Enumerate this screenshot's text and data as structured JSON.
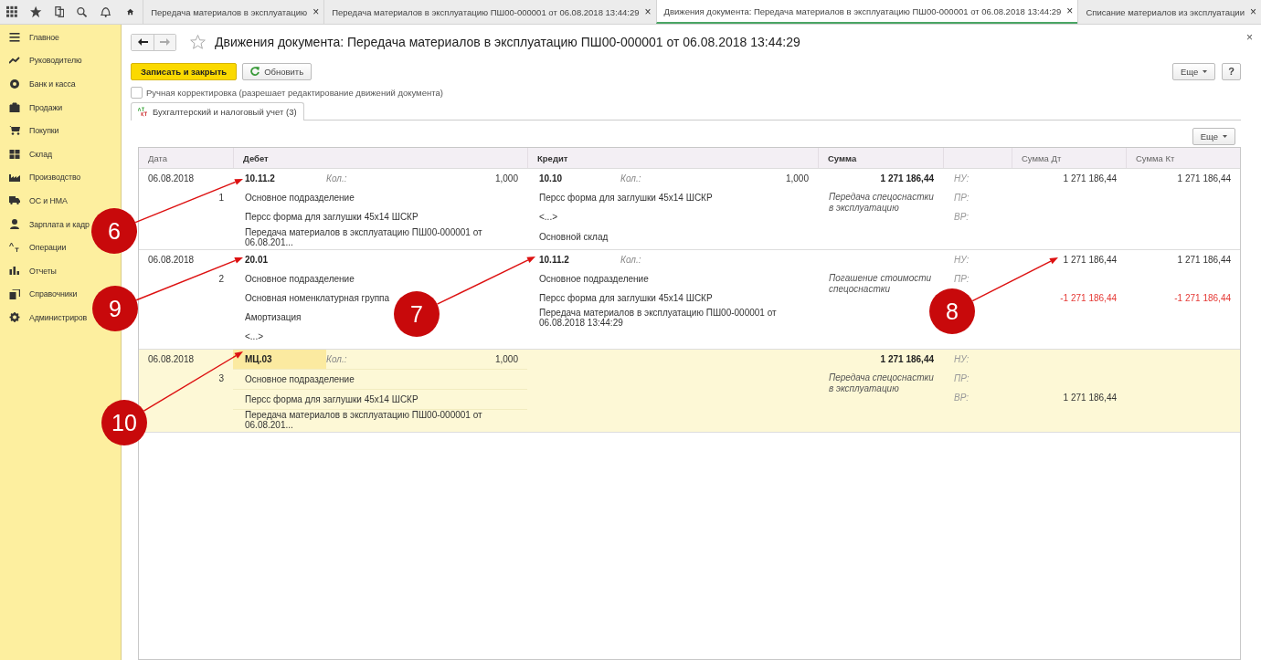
{
  "tabs": [
    {
      "label": "Передача материалов в эксплуатацию",
      "selected": false
    },
    {
      "label": "Передача материалов в эксплуатацию ПШ00-000001 от 06.08.2018 13:44:29",
      "selected": false
    },
    {
      "label": "Движения документа: Передача материалов в эксплуатацию ПШ00-000001 от 06.08.2018 13:44:29",
      "selected": true
    },
    {
      "label": "Списание материалов из эксплуатации",
      "selected": false
    }
  ],
  "tab_close": "×",
  "sidebar": {
    "items": [
      {
        "label": "Главное",
        "kind": "menu"
      },
      {
        "label": "Руководителю",
        "kind": "trend"
      },
      {
        "label": "Банк и касса",
        "kind": "coin"
      },
      {
        "label": "Продажи",
        "kind": "bag"
      },
      {
        "label": "Покупки",
        "kind": "cart"
      },
      {
        "label": "Склад",
        "kind": "grid"
      },
      {
        "label": "Производство",
        "kind": "factory"
      },
      {
        "label": "ОС и НМА",
        "kind": "truck"
      },
      {
        "label": "Зарплата и кадр",
        "kind": "person"
      },
      {
        "label": "Операции",
        "kind": "dtkt"
      },
      {
        "label": "Отчеты",
        "kind": "bars"
      },
      {
        "label": "Справочники",
        "kind": "books"
      },
      {
        "label": "Администриров",
        "kind": "gear"
      }
    ]
  },
  "form": {
    "title": "Движения документа: Передача материалов в эксплуатацию ПШ00-000001 от 06.08.2018 13:44:29",
    "close": "×",
    "buttons": [
      {
        "label": "Записать и закрыть",
        "kind": "primary"
      },
      {
        "label": "Обновить",
        "kind": "refresh"
      }
    ],
    "more": "Еще",
    "help": "?",
    "manual_edit": {
      "label": "Ручная корректировка (разрешает редактирование движений документа)",
      "checked": false
    },
    "section_tab": {
      "label": "Бухгалтерский и налоговый учет (3)",
      "selected": true
    },
    "table_more": "Еще"
  },
  "table": {
    "columns": [
      "Дата",
      "Дебет",
      "Кредит",
      "Сумма",
      "Сумма Дт",
      "Сумма Кт"
    ],
    "rows": [
      {
        "date": "06.08.2018",
        "number": "1",
        "selected": false,
        "debit": {
          "account": "10.11.2",
          "qty_label": "Кол.:",
          "qty": "1,000",
          "lines": [
            "Основное подразделение",
            "Персс форма для заглушки 45x14 ШСКР",
            "Передача материалов в эксплуатацию ПШ00-000001 от 06.08.201..."
          ]
        },
        "credit": {
          "account": "10.10",
          "qty_label": "Кол.:",
          "qty": "1,000",
          "lines": [
            "Персс форма для заглушки 45x14 ШСКР",
            "<...>",
            "Основной склад"
          ]
        },
        "sum": "1 271 186,44",
        "comment": "Передача спецоснастки в эксплуатацию",
        "tax_lines": [
          {
            "label": "НУ:",
            "dt": {
              "text": "1 271 186,44",
              "negative": false
            },
            "kt": {
              "text": "1 271 186,44",
              "negative": false
            }
          },
          {
            "label": "ПР:"
          },
          {
            "label": "ВР:"
          }
        ]
      },
      {
        "date": "06.08.2018",
        "number": "2",
        "selected": false,
        "debit": {
          "account": "20.01",
          "lines": [
            "Основное подразделение",
            "Основная номенклатурная группа",
            "Амортизация",
            "<...>"
          ]
        },
        "credit": {
          "account": "10.11.2",
          "qty_label": "Кол.:",
          "lines": [
            "Основное подразделение",
            "Персс форма для заглушки 45x14 ШСКР",
            "Передача материалов в эксплуатацию ПШ00-000001 от 06.08.2018 13:44:29"
          ]
        },
        "comment": "Погашение стоимости спецоснастки",
        "tax_lines": [
          {
            "label": "НУ:",
            "dt": {
              "text": "1 271 186,44",
              "negative": false
            },
            "kt": {
              "text": "1 271 186,44",
              "negative": false
            }
          },
          {
            "label": "ПР:"
          },
          {
            "dt": {
              "text": "-1 271 186,44",
              "negative": true
            },
            "kt": {
              "text": "-1 271 186,44",
              "negative": true
            }
          }
        ]
      },
      {
        "date": "06.08.2018",
        "number": "3",
        "selected": true,
        "debit": {
          "account": "МЦ.03",
          "qty_label": "Кол.:",
          "qty": "1,000",
          "lines": [
            "Основное подразделение",
            "Персс форма для заглушки 45x14 ШСКР",
            "Передача материалов в эксплуатацию ПШ00-000001 от 06.08.201..."
          ]
        },
        "sum": "1 271 186,44",
        "comment": "Передача спецоснастки в эксплуатацию",
        "tax_lines": [
          {
            "label": "НУ:"
          },
          {
            "label": "ПР:"
          },
          {
            "label": "ВР:",
            "dt": {
              "text": "1 271 186,44",
              "negative": false
            }
          }
        ]
      }
    ]
  },
  "callouts": [
    {
      "label": "6"
    },
    {
      "label": "9"
    },
    {
      "label": "10"
    },
    {
      "label": "7"
    },
    {
      "label": "8"
    }
  ]
}
